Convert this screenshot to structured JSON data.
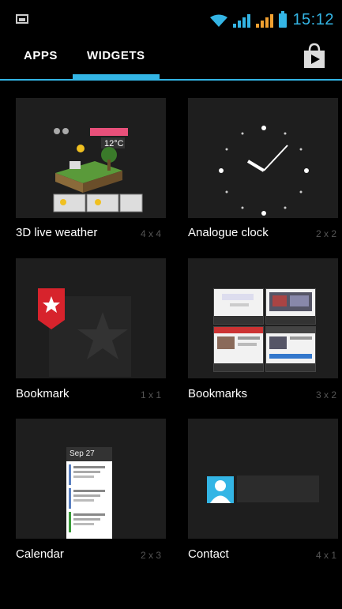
{
  "status_bar": {
    "time": "15:12"
  },
  "tabs": [
    {
      "label": "APPS",
      "selected": false
    },
    {
      "label": "WIDGETS",
      "selected": true
    }
  ],
  "accent_color": "#33b5e5",
  "store_icon": "play-store-bag-icon",
  "widgets": [
    {
      "name": "3D live weather",
      "size": "4 x 4"
    },
    {
      "name": "Analogue clock",
      "size": "2 x 2"
    },
    {
      "name": "Bookmark",
      "size": "1 x 1"
    },
    {
      "name": "Bookmarks",
      "size": "3 x 2"
    },
    {
      "name": "Calendar",
      "size": "2 x 3"
    },
    {
      "name": "Contact",
      "size": "4 x 1"
    }
  ],
  "previews": {
    "weather_temp": "12°C",
    "calendar_date": "Sep 27"
  }
}
